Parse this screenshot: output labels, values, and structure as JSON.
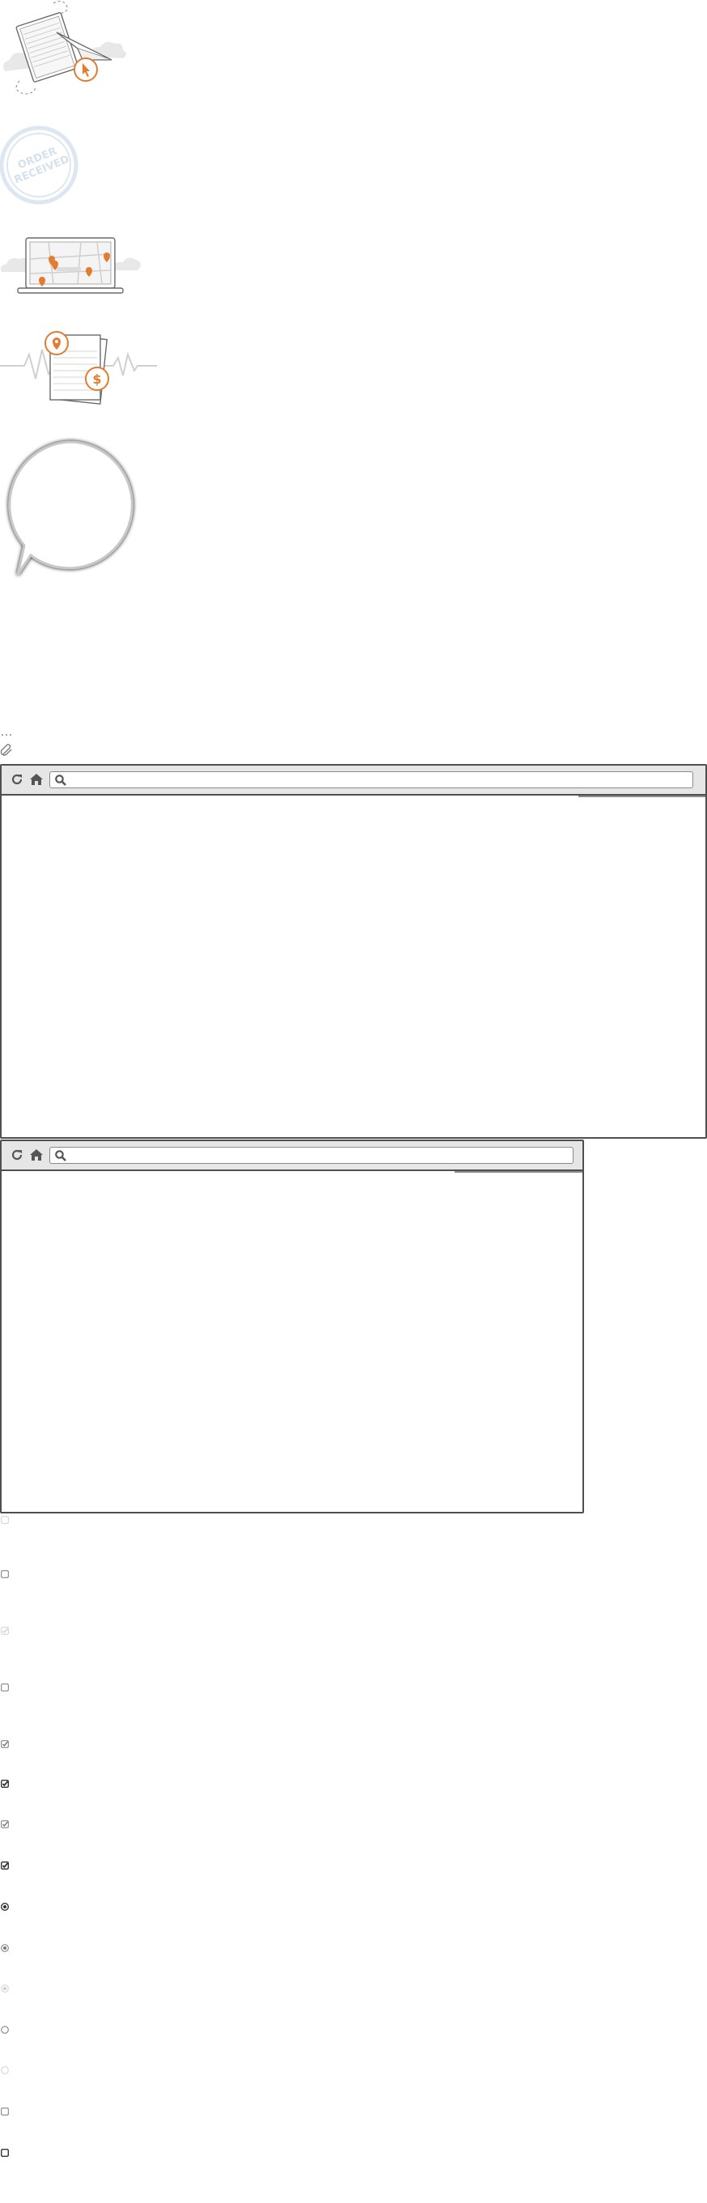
{
  "illustrations": {
    "document_click": {
      "icon": "document-click-icon",
      "accent": "#e57b2e"
    },
    "order_stamp": {
      "icon": "order-received-stamp-icon",
      "text": "ORDER RECEIVED",
      "color": "#dde7f1"
    },
    "map_laptop": {
      "icon": "laptop-map-icon",
      "accent": "#e57b2e"
    },
    "pin_pages": {
      "icon": "location-price-pages-icon",
      "accent": "#e57b2e"
    },
    "speech_bubble": {
      "icon": "speech-bubble-icon"
    }
  },
  "small_icons": {
    "dots": "ellipsis-icon",
    "attach": "paperclip-icon"
  },
  "browsers": [
    {
      "reload_icon": "reload-icon",
      "home_icon": "home-icon",
      "search_icon": "search-icon",
      "url_text": "",
      "loading_progress": 0.18
    },
    {
      "reload_icon": "reload-icon",
      "home_icon": "home-icon",
      "search_icon": "search-icon",
      "url_text": "",
      "loading_progress": 0.22
    }
  ],
  "controls": [
    {
      "type": "checkbox",
      "state": "unchecked",
      "style": "faint"
    },
    {
      "type": "checkbox",
      "state": "unchecked",
      "style": "normal"
    },
    {
      "type": "checkbox",
      "state": "checked",
      "style": "faint"
    },
    {
      "type": "checkbox",
      "state": "unchecked",
      "style": "normal"
    },
    {
      "type": "checkbox",
      "state": "checked",
      "style": "normal"
    },
    {
      "type": "checkbox",
      "state": "checked",
      "style": "bold"
    },
    {
      "type": "checkbox",
      "state": "checked",
      "style": "normal"
    },
    {
      "type": "checkbox",
      "state": "checked",
      "style": "bold"
    },
    {
      "type": "radio",
      "state": "selected",
      "style": "bold"
    },
    {
      "type": "radio",
      "state": "selected",
      "style": "normal"
    },
    {
      "type": "radio",
      "state": "selected",
      "style": "faint"
    },
    {
      "type": "radio",
      "state": "unselected",
      "style": "normal"
    },
    {
      "type": "radio",
      "state": "unselected",
      "style": "faint"
    },
    {
      "type": "checkbox",
      "state": "unchecked",
      "style": "normal"
    },
    {
      "type": "checkbox",
      "state": "unchecked",
      "style": "bold"
    }
  ]
}
